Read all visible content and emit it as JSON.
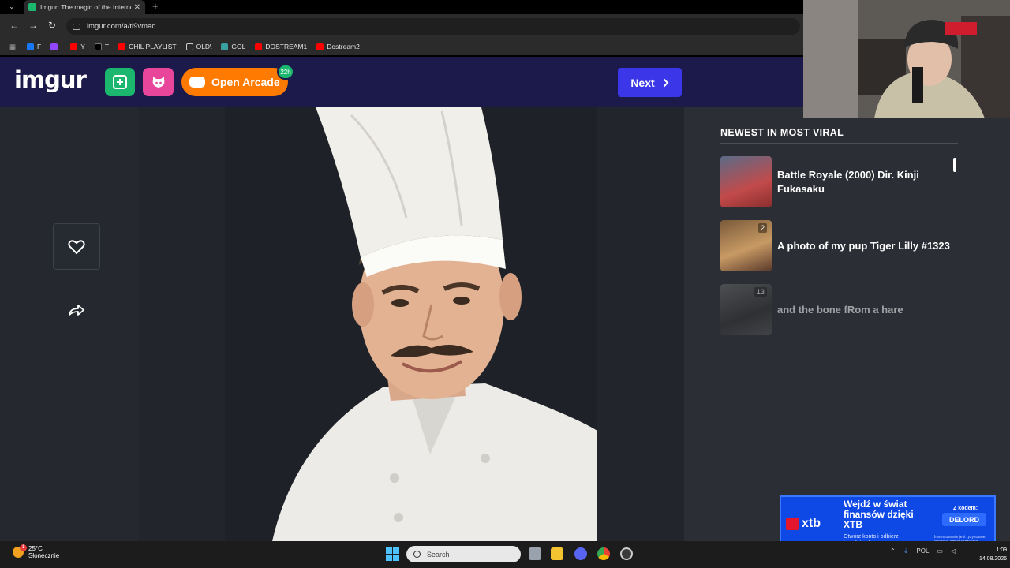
{
  "browser": {
    "tab_title": "Imgur: The magic of the Internet",
    "tab_close": "✕",
    "new_tab": "+",
    "url": "imgur.com/a/tl9vmaq",
    "bookmarks": [
      {
        "label": "F",
        "color": "#1877f2"
      },
      {
        "label": "",
        "color": "#9146ff"
      },
      {
        "label": "Y",
        "color": "#ff0000"
      },
      {
        "label": "T",
        "color": "#000000"
      },
      {
        "label": "CHIL PLAYLIST",
        "color": "#ff0000"
      },
      {
        "label": "OLD\\",
        "color": "#888888"
      },
      {
        "label": "GOL",
        "color": "#3aa0a0"
      },
      {
        "label": "DOSTREAM1",
        "color": "#ff0000"
      },
      {
        "label": "Dostream2",
        "color": "#ff0000"
      }
    ]
  },
  "header": {
    "logo": "imgur",
    "arcade_label": "Open Arcade",
    "arcade_badge": "22h",
    "next_label": "Next",
    "next_icon": "chevron-right-icon",
    "colors": {
      "bg": "#1b1a4a",
      "upload": "#1bb76e",
      "ghost": "#e8469a",
      "arcade": "#ff7a00",
      "next": "#3b37e8"
    }
  },
  "post": {
    "favorite_icon": "heart-icon",
    "share_icon": "share-arrow-icon"
  },
  "sidebar": {
    "title": "NEWEST IN MOST VIRAL",
    "items": [
      {
        "title": "Battle Royale (2000) Dir. Kinji Fukasaku",
        "count": ""
      },
      {
        "title": "A photo of my pup Tiger Lilly #1323",
        "count": "2"
      },
      {
        "title": "and the bone fRom a hare",
        "count": "13"
      }
    ]
  },
  "ad": {
    "brand": "xtb",
    "headline": "Wejdź w świat finansów dzięki XTB",
    "sub": "Otwórz konto i odbierz bezpłatny kurs",
    "code_label": "Z kodem:",
    "code": "DELORD",
    "fine": "Inwestowanie jest ryzykowne. Inwestuj odpowiedzialnie."
  },
  "taskbar": {
    "weather_temp": "25°C",
    "weather_desc": "Słonecznie",
    "weather_alert": "1",
    "search_placeholder": "Search",
    "lang": "POL",
    "time": "1:09",
    "date": "14.08.2026"
  }
}
